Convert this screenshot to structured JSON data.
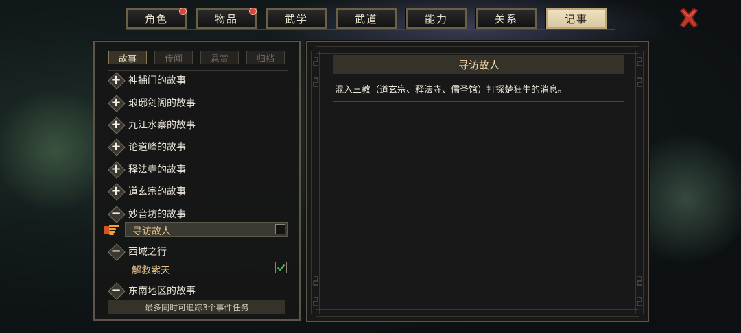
{
  "tabs": [
    {
      "label": "角色",
      "badge": true
    },
    {
      "label": "物品",
      "badge": true
    },
    {
      "label": "武学",
      "badge": false
    },
    {
      "label": "武道",
      "badge": false
    },
    {
      "label": "能力",
      "badge": false
    },
    {
      "label": "关系",
      "badge": false
    },
    {
      "label": "记事",
      "badge": false,
      "active": true
    }
  ],
  "subtabs": [
    "故事",
    "传闻",
    "悬赏",
    "归档"
  ],
  "stories": [
    {
      "label": "神捕门的故事",
      "state": "collapsed"
    },
    {
      "label": "琅琊剑阁的故事",
      "state": "collapsed"
    },
    {
      "label": "九江水寨的故事",
      "state": "collapsed"
    },
    {
      "label": "论道峰的故事",
      "state": "collapsed"
    },
    {
      "label": "释法寺的故事",
      "state": "collapsed"
    },
    {
      "label": "道玄宗的故事",
      "state": "collapsed"
    },
    {
      "label": "妙音坊的故事",
      "state": "expanded"
    },
    {
      "label": "西域之行",
      "state": "expanded"
    },
    {
      "label": "东南地区的故事",
      "state": "expanded"
    }
  ],
  "selected_quest": {
    "label": "寻访故人",
    "tracked": false
  },
  "sub_quest": {
    "label": "解救紫天",
    "tracked": true
  },
  "footer": "最多同时可追踪3个事件任务",
  "detail": {
    "title": "寻访故人",
    "description": "混入三教（道玄宗、释法寺、儒圣馆）打探楚狂生的消息。"
  },
  "colors": {
    "accent_gold": "#e8c48a",
    "active_tab": "#e6d7b2",
    "badge_red": "#d9473c",
    "check_green": "#4fbf5a"
  },
  "icons": {
    "close": "close-x-icon",
    "pointer": "pointing-hand-icon",
    "expand": "plus-icon",
    "collapse": "minus-icon"
  }
}
